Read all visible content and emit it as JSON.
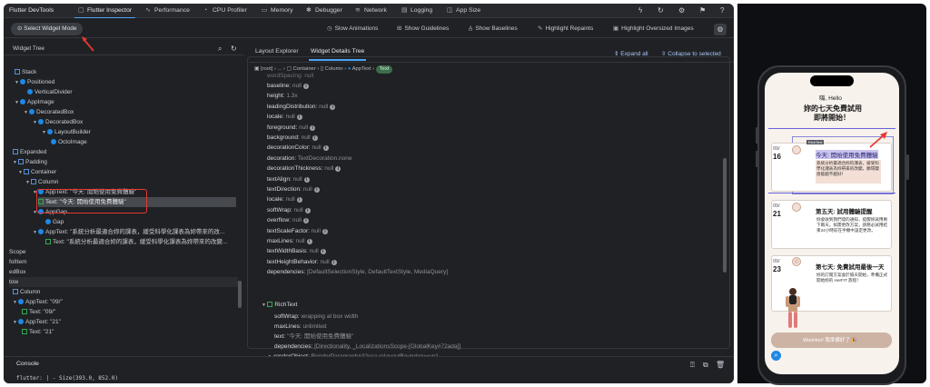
{
  "app_title": "Flutter DevTools",
  "tabs": [
    {
      "label": "Flutter Inspector",
      "icon": "inspector-icon",
      "active": true
    },
    {
      "label": "Performance",
      "icon": "performance-icon"
    },
    {
      "label": "CPU Profiler",
      "icon": "cpu-icon"
    },
    {
      "label": "Memory",
      "icon": "memory-icon"
    },
    {
      "label": "Debugger",
      "icon": "debugger-icon"
    },
    {
      "label": "Network",
      "icon": "network-icon"
    },
    {
      "label": "Logging",
      "icon": "logging-icon"
    },
    {
      "label": "App Size",
      "icon": "appsize-icon"
    }
  ],
  "toolbar": {
    "select_widget_mode": "Select Widget Mode",
    "slow_animations": "Slow Animations",
    "show_guidelines": "Show Guidelines",
    "show_baselines": "Show Baselines",
    "highlight_repaints": "Highlight Repaints",
    "highlight_oversized": "Highlight Oversized Images"
  },
  "tree": {
    "title": "Widget Tree",
    "rows": [
      {
        "text": "Stack"
      },
      {
        "text": "Positioned"
      },
      {
        "text": "VerticalDivider"
      },
      {
        "text": "AppImage"
      },
      {
        "text": "DecoratedBox"
      },
      {
        "text": "DecoratedBox"
      },
      {
        "text": "LayoutBuilder"
      },
      {
        "text": "OctoImage"
      },
      {
        "text": "Expanded"
      },
      {
        "text": "Padding"
      },
      {
        "text": "Container"
      },
      {
        "text": "Column"
      },
      {
        "text": "AppText: \"今天: 開始使用免費體驗\""
      },
      {
        "text": "Text: \"今天: 開始使用免費體驗\""
      },
      {
        "text": "AppGap"
      },
      {
        "text": "Gap"
      },
      {
        "text": "AppText: \"系統分析最適合妳的課表，緩受科學化課表為妳帶來的改..."
      },
      {
        "text": "Text: \"系統分析最適合妳的課表，緩受科學化課表為妳帶來的改變..."
      },
      {
        "text": "Scope"
      },
      {
        "text": "folItem"
      },
      {
        "text": "edBox"
      },
      {
        "text": "tow"
      },
      {
        "text": "Column"
      },
      {
        "text": "AppText: \"09/\""
      },
      {
        "text": "Text: \"09/\""
      },
      {
        "text": "AppText: \"21\""
      },
      {
        "text": "Text: \"21\""
      }
    ]
  },
  "details": {
    "tab_layout": "Layout Explorer",
    "tab_details": "Widget Details Tree",
    "expand_all": "Expand all",
    "collapse": "Collapse to selected",
    "breadcrumbs": [
      "[root]",
      "...",
      "Container",
      "Column",
      "AppText",
      "Text"
    ],
    "top_clipped": "wordSpacing: null",
    "props": [
      {
        "name": "baseline",
        "value": "null"
      },
      {
        "name": "height",
        "value": "1.3x"
      },
      {
        "name": "leadingDistribution",
        "value": "null"
      },
      {
        "name": "locale",
        "value": "null"
      },
      {
        "name": "foreground",
        "value": "null"
      },
      {
        "name": "background",
        "value": "null"
      },
      {
        "name": "decorationColor",
        "value": "null"
      },
      {
        "name": "decoration",
        "value": "TextDecoration.none"
      },
      {
        "name": "decorationThickness",
        "value": "null"
      },
      {
        "name": "textAlign",
        "value": "null"
      },
      {
        "name": "textDirection",
        "value": "null"
      },
      {
        "name": "locale",
        "value": "null"
      },
      {
        "name": "softWrap",
        "value": "null"
      },
      {
        "name": "overflow",
        "value": "null"
      },
      {
        "name": "textScaleFactor",
        "value": "null"
      },
      {
        "name": "maxLines",
        "value": "null"
      },
      {
        "name": "textWidthBasis",
        "value": "null"
      },
      {
        "name": "textHeightBehavior",
        "value": "null"
      },
      {
        "name": "dependencies",
        "value": "[DefaultSelectionStyle, DefaultTextStyle, MediaQuery]"
      }
    ],
    "richtext": "RichText",
    "rich_props": [
      {
        "name": "softWrap",
        "value": "wrapping at box width"
      },
      {
        "name": "maxLines",
        "value": "unlimited"
      },
      {
        "name": "text",
        "value": "\"今天: 開始使用免費體驗\""
      },
      {
        "name": "dependencies",
        "value": "[Directionality, _LocalizationsScope-[GlobalKey#72ada]]"
      }
    ],
    "render_object": {
      "name": "renderObject",
      "value": "RenderParagraph#42esa relayoutBoundary=up1"
    }
  },
  "console": {
    "title": "Console",
    "output": "flutter: | - Size(393.0, 852.0)"
  },
  "phone": {
    "greeting": "嗨, Hello",
    "headline1": "妳的七天免費試用",
    "headline2": "即將開始！",
    "tooltip": "RichText",
    "items": [
      {
        "month": "09/",
        "day": "16",
        "title": "今天: 開始使用免費體驗",
        "body": "系統分析最適合妳的課表，緩受科學化課表為妳帶來的改變，願環變感能越不越好！"
      },
      {
        "month": "09/",
        "day": "21",
        "title": "第五天: 試用體驗提醒",
        "body": "妳會收到我們發的通知，提醒妳試用剩下兩天，如需更改方案，請務必試用結束24小時前在手機中設定更改。"
      },
      {
        "month": "09/",
        "day": "23",
        "title": "第七天: 免費試用最後一天",
        "body": "妳的訂閱方案會於隔天開始，準備正式開始妳的 HerFIT 旅程！"
      }
    ],
    "cta": "WooHoo! 我準備好了 🎉"
  }
}
